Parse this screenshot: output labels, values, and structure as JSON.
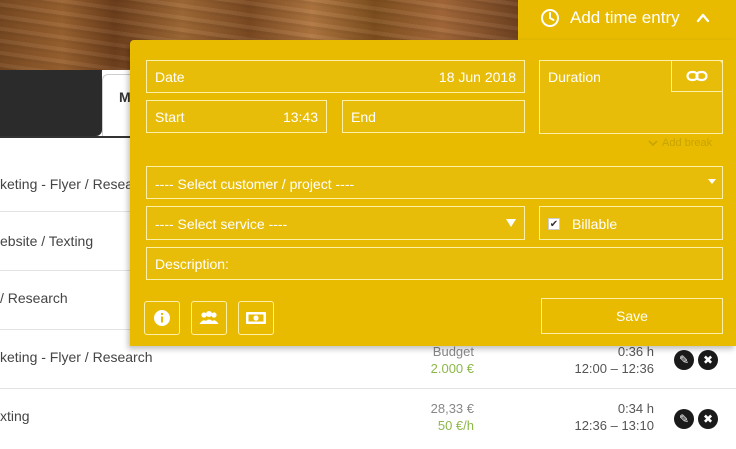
{
  "header": {
    "add_time_entry": "Add time entry"
  },
  "tabs": {
    "active_tab_label": "M"
  },
  "form": {
    "date_label": "Date",
    "date_value": "18 Jun 2018",
    "start_label": "Start",
    "start_value": "13:43",
    "end_label": "End",
    "duration_label": "Duration",
    "add_break": "Add break",
    "customer_placeholder": "---- Select customer / project ----",
    "service_placeholder": "---- Select service ----",
    "billable_label": "Billable",
    "billable_checked": true,
    "description_label": "Description:",
    "save_label": "Save"
  },
  "rows": [
    {
      "label": "keting - Flyer / Research"
    },
    {
      "label": "ebsite / Texting"
    },
    {
      "label": "/ Research"
    },
    {
      "label": "keting - Flyer / Research",
      "money_top": "Budget",
      "money_bottom": "2.000 €",
      "duration": "0:36 h",
      "time_range": "12:00 – 12:36"
    },
    {
      "label": "xting",
      "money_top": "28,33 €",
      "money_bottom": "50 €/h",
      "duration": "0:34 h",
      "time_range": "12:36 – 13:10"
    }
  ],
  "colors": {
    "panel": "#e8bb00",
    "field_border": "#fff0a8",
    "budget_green": "#8db84a"
  },
  "icons": [
    "clock-icon",
    "chevron-up-icon",
    "link-icon",
    "chevron-down-icon",
    "info-icon",
    "team-icon",
    "money-icon",
    "edit-icon",
    "tools-icon"
  ]
}
